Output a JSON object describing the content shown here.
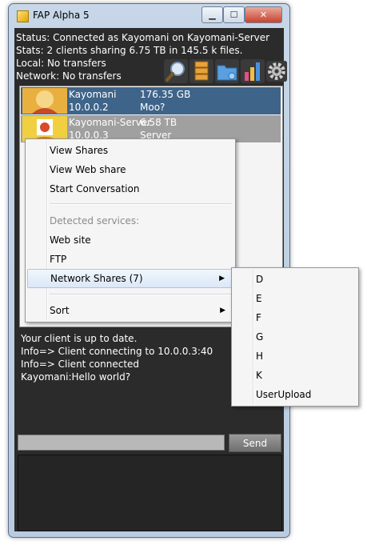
{
  "window": {
    "title": "FAP Alpha 5",
    "minimize": "▁",
    "maximize": "☐",
    "close": "✕"
  },
  "status": {
    "connection": "Status: Connected as Kayomani on Kayomani-Server",
    "stats": "Stats: 2 clients sharing 6.75 TB in 145.5 k files.",
    "local": "Local: No transfers",
    "network": "Network: No transfers"
  },
  "toolbar": {
    "icons": [
      "search-icon",
      "database-icon",
      "network-folder-icon",
      "bar-chart-icon",
      "gear-icon"
    ]
  },
  "clients": [
    {
      "name": "Kayomani",
      "size": "176.35 GB",
      "ip": "10.0.0.2",
      "description": "Moo?"
    },
    {
      "name": "Kayomani-Server",
      "size": "6.58 TB",
      "ip": "10.0.0.3",
      "description": "Server"
    }
  ],
  "context_menu": {
    "view_shares": "View Shares",
    "view_web_share": "View Web share",
    "start_conversation": "Start Conversation",
    "detected_services": "Detected services:",
    "web_site": "Web site",
    "ftp": "FTP",
    "network_shares": "Network Shares (7)",
    "sort": "Sort"
  },
  "submenu": {
    "items": [
      "D",
      "E",
      "F",
      "G",
      "H",
      "K",
      "UserUpload"
    ]
  },
  "log": {
    "lines": [
      "Your client is up to date.",
      "Info=> Client connecting to 10.0.0.3:40",
      "Info=> Client connected",
      "Kayomani:Hello world?"
    ]
  },
  "chat": {
    "input_value": "",
    "send_label": "Send"
  },
  "colors": {
    "selected_row": "#3f6489",
    "hover_row": "#a0a0a0",
    "client_bg": "#2b2b2b"
  }
}
